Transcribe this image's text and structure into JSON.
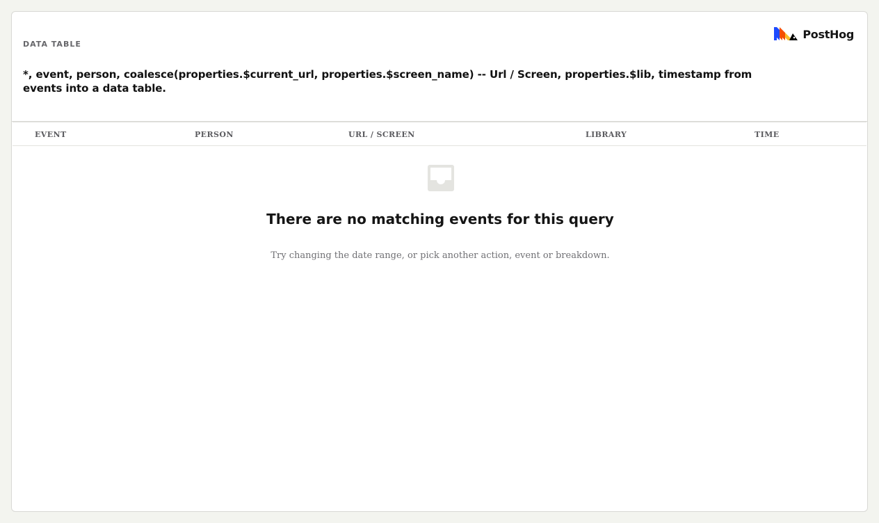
{
  "card": {
    "kind_label": "DATA TABLE",
    "query_title": "*, event, person, coalesce(properties.$current_url, properties.$screen_name) -- Url / Screen, properties.$lib, timestamp from events into a data table.",
    "logo": {
      "text": "PostHog",
      "icon": "posthog-logo-icon",
      "colors": [
        "#1d4aff",
        "#f54e00",
        "#f9bd2b",
        "#000000"
      ]
    }
  },
  "table": {
    "columns": [
      "EVENT",
      "PERSON",
      "URL / SCREEN",
      "LIBRARY",
      "TIME"
    ],
    "rows": []
  },
  "empty_state": {
    "icon": "inbox-empty-icon",
    "title": "There are no matching events for this query",
    "description": "Try changing the date range, or pick another action, event or breakdown."
  },
  "colors": {
    "page_background": "#f3f4ef",
    "card_background": "#ffffff",
    "border": "#d9d9d5",
    "muted_text": "#707074"
  }
}
